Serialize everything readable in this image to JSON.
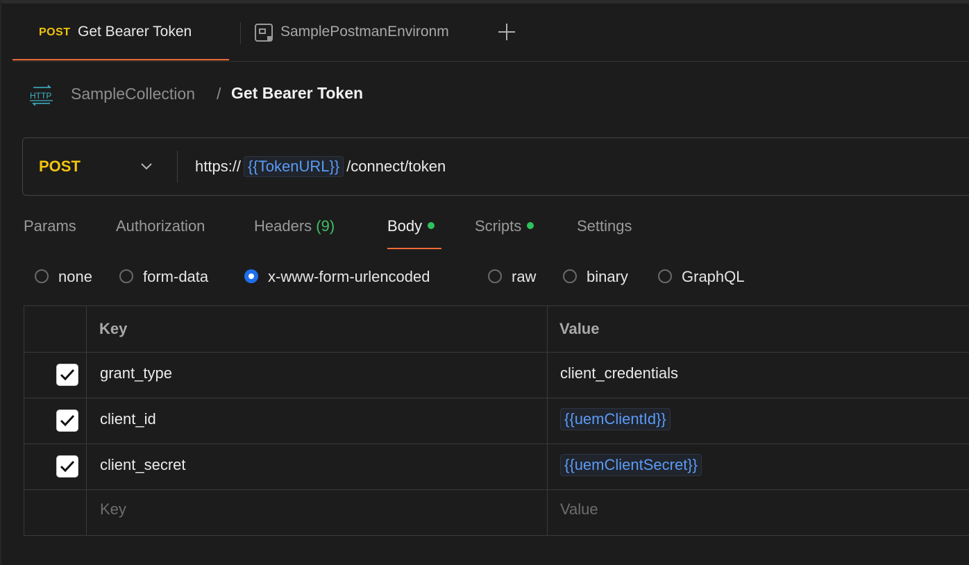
{
  "tabs": {
    "active": {
      "method": "POST",
      "title": "Get Bearer Token"
    },
    "environment": {
      "title": "SamplePostmanEnvironm",
      "icon": "environment-icon"
    },
    "new_tab_icon": "plus-icon"
  },
  "breadcrumb": {
    "icon": "http-icon",
    "icon_text": "HTTP",
    "parent": "SampleCollection",
    "separator": "/",
    "current": "Get Bearer Token"
  },
  "request": {
    "method": "POST",
    "url_prefix": "https://",
    "url_variable": "{{TokenURL}}",
    "url_suffix": "/connect/token"
  },
  "request_tabs": [
    {
      "label": "Params"
    },
    {
      "label": "Authorization"
    },
    {
      "label": "Headers",
      "count": "(9)"
    },
    {
      "label": "Body",
      "active": true,
      "dot": true
    },
    {
      "label": "Scripts",
      "dot": true
    },
    {
      "label": "Settings"
    }
  ],
  "body_types": {
    "selected": "x-www-form-urlencoded",
    "options": [
      "none",
      "form-data",
      "x-www-form-urlencoded",
      "raw",
      "binary",
      "GraphQL"
    ]
  },
  "table": {
    "headers": {
      "key": "Key",
      "value": "Value"
    },
    "rows": [
      {
        "checked": true,
        "key": "grant_type",
        "value": "client_credentials",
        "value_is_variable": false
      },
      {
        "checked": true,
        "key": "client_id",
        "value": "{{uemClientId}}",
        "value_is_variable": true
      },
      {
        "checked": true,
        "key": "client_secret",
        "value": "{{uemClientSecret}}",
        "value_is_variable": true
      }
    ],
    "placeholder": {
      "key": "Key",
      "value": "Value"
    }
  },
  "colors": {
    "accent": "#f26b3a",
    "method_post": "#f1c40f",
    "variable": "#5b9bf5",
    "status_dot": "#2fc15f",
    "radio_selected": "#1f6feb"
  }
}
